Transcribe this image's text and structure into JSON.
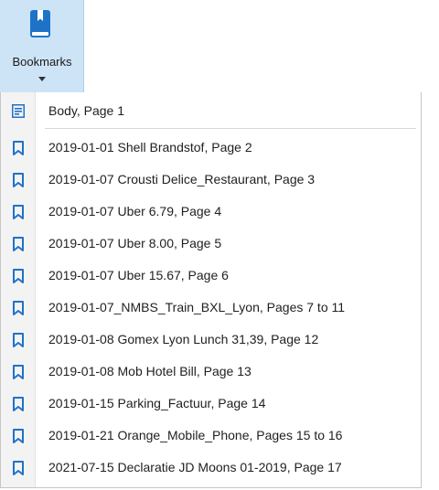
{
  "ribbon": {
    "button_label": "Bookmarks",
    "icon": "bookmark-book-icon",
    "accent": "#1e73c7"
  },
  "menu": {
    "first_item": {
      "label": "Body, Page 1",
      "icon": "document-lines-icon"
    },
    "bookmarks": [
      {
        "label": "2019-01-01 Shell Brandstof, Page 2"
      },
      {
        "label": "2019-01-07 Crousti Delice_Restaurant, Page 3"
      },
      {
        "label": "2019-01-07 Uber 6.79, Page 4"
      },
      {
        "label": "2019-01-07 Uber 8.00, Page 5"
      },
      {
        "label": "2019-01-07 Uber 15.67, Page 6"
      },
      {
        "label": "2019-01-07_NMBS_Train_BXL_Lyon, Pages 7 to 11"
      },
      {
        "label": "2019-01-08 Gomex Lyon Lunch 31,39, Page 12"
      },
      {
        "label": "2019-01-08 Mob Hotel Bill, Page 13"
      },
      {
        "label": "2019-01-15 Parking_Factuur, Page 14"
      },
      {
        "label": "2019-01-21 Orange_Mobile_Phone, Pages 15 to 16"
      },
      {
        "label": "2021-07-15 Declaratie JD Moons 01-2019, Page 17"
      }
    ],
    "bookmark_icon": "bookmark-icon",
    "icon_color": "#1e73c7"
  }
}
